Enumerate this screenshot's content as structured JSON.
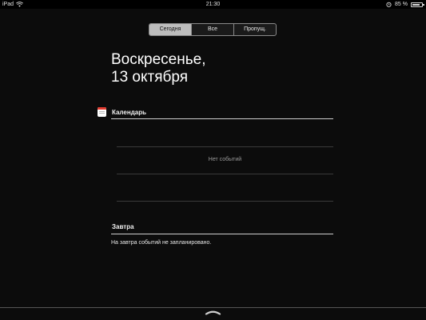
{
  "status_bar": {
    "device": "iPad",
    "time": "21:30",
    "battery": "85 %",
    "battery_level": 0.85
  },
  "tabs": [
    {
      "label": "Сегодня",
      "selected": true
    },
    {
      "label": "Все",
      "selected": false
    },
    {
      "label": "Пропущ.",
      "selected": false
    }
  ],
  "date": {
    "weekday": "Воскресенье,",
    "day_month": "13 октября"
  },
  "calendar": {
    "title": "Календарь",
    "empty_text": "Нет событий"
  },
  "tomorrow": {
    "title": "Завтра",
    "text": "На завтра событий не запланировано."
  },
  "colors": {
    "background": "#0c0c0c",
    "calendar_icon_red": "#e23a2e"
  }
}
